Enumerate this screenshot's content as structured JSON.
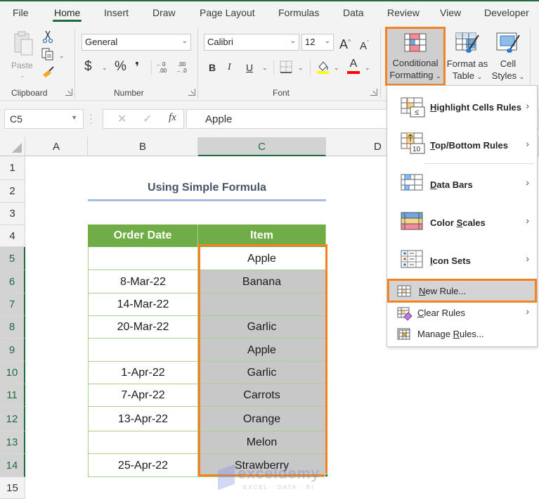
{
  "tabs": [
    {
      "label": "File",
      "active": false
    },
    {
      "label": "Home",
      "active": true
    },
    {
      "label": "Insert",
      "active": false
    },
    {
      "label": "Draw",
      "active": false
    },
    {
      "label": "Page Layout",
      "active": false
    },
    {
      "label": "Formulas",
      "active": false
    },
    {
      "label": "Data",
      "active": false
    },
    {
      "label": "Review",
      "active": false
    },
    {
      "label": "View",
      "active": false
    },
    {
      "label": "Developer",
      "active": false
    }
  ],
  "ribbon": {
    "clipboard": {
      "paste_label": "Paste",
      "group_label": "Clipboard"
    },
    "number": {
      "format_value": "General",
      "currency": "$",
      "percent": "%",
      "comma": "❜",
      "increase_decimal": "←.0 .00",
      "decrease_decimal": ".00 →.0",
      "group_label": "Number"
    },
    "font": {
      "font_name": "Calibri",
      "font_size": "12",
      "grow": "A",
      "shrink": "A",
      "bold": "B",
      "italic": "I",
      "underline": "U",
      "font_color_glyph": "A",
      "group_label": "Font",
      "fill_color": "#ffff00",
      "font_color": "#ff0000"
    },
    "styles": {
      "conditional_formatting": {
        "line1": "Conditional",
        "line2": "Formatting"
      },
      "format_as_table": {
        "line1": "Format as",
        "line2": "Table"
      },
      "cell_styles": {
        "line1": "Cell",
        "line2": "Styles"
      }
    }
  },
  "formula_bar": {
    "name_box": "C5",
    "cancel": "✕",
    "enter": "✓",
    "fx": "fx",
    "value": "Apple"
  },
  "sheet": {
    "columns": [
      "A",
      "B",
      "C",
      "D"
    ],
    "selected_column": "C",
    "rows": [
      "1",
      "2",
      "3",
      "4",
      "5",
      "6",
      "7",
      "8",
      "9",
      "10",
      "11",
      "12",
      "13",
      "14",
      "15"
    ],
    "title": "Using Simple Formula",
    "headers": {
      "order_date": "Order Date",
      "item": "Item"
    },
    "data": [
      {
        "row": "5",
        "date": "",
        "item": "Apple"
      },
      {
        "row": "6",
        "date": "8-Mar-22",
        "item": "Banana"
      },
      {
        "row": "7",
        "date": "14-Mar-22",
        "item": ""
      },
      {
        "row": "8",
        "date": "20-Mar-22",
        "item": "Garlic"
      },
      {
        "row": "9",
        "date": "",
        "item": "Apple"
      },
      {
        "row": "10",
        "date": "1-Apr-22",
        "item": "Garlic"
      },
      {
        "row": "11",
        "date": "7-Apr-22",
        "item": "Carrots"
      },
      {
        "row": "12",
        "date": "13-Apr-22",
        "item": "Orange"
      },
      {
        "row": "13",
        "date": "",
        "item": "Melon"
      },
      {
        "row": "14",
        "date": "25-Apr-22",
        "item": "Strawberry"
      }
    ],
    "header_color": "#70ad47",
    "item_fill_color": "#c8c8c8",
    "highlight_color": "#f58220"
  },
  "cf_menu": {
    "items": [
      {
        "pre": "",
        "u": "H",
        "post": "ighlight Cells Rules",
        "submenu": true,
        "icon": "highlight-cells-icon"
      },
      {
        "pre": "",
        "u": "T",
        "post": "op/Bottom Rules",
        "submenu": true,
        "icon": "top-bottom-icon"
      },
      {
        "pre": "",
        "u": "D",
        "post": "ata Bars",
        "submenu": true,
        "icon": "data-bars-icon"
      },
      {
        "pre": "Color ",
        "u": "S",
        "post": "cales",
        "submenu": true,
        "icon": "color-scales-icon"
      },
      {
        "pre": "",
        "u": "I",
        "post": "con Sets",
        "submenu": true,
        "icon": "icon-sets-icon"
      },
      {
        "pre": "",
        "u": "N",
        "post": "ew Rule...",
        "submenu": false,
        "icon": "new-rule-icon",
        "highlighted": true
      },
      {
        "pre": "",
        "u": "C",
        "post": "lear Rules",
        "submenu": true,
        "icon": "clear-rules-icon"
      },
      {
        "pre": "Manage ",
        "u": "R",
        "post": "ules...",
        "submenu": false,
        "icon": "manage-rules-icon"
      }
    ],
    "chevron": "›"
  },
  "watermark": {
    "main": "exceldemy",
    "sub": "EXCEL · DATA · BI"
  }
}
